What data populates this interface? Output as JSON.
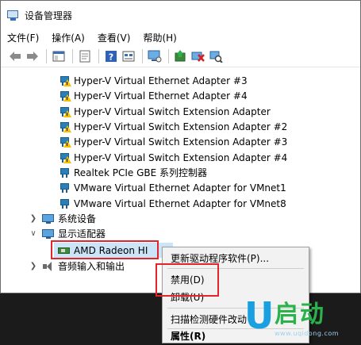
{
  "window": {
    "title": "设备管理器"
  },
  "menubar": {
    "items": [
      "文件(F)",
      "操作(A)",
      "查看(V)",
      "帮助(H)"
    ]
  },
  "toolbar": {
    "icons": [
      "back-arrow-icon",
      "forward-arrow-icon",
      "show-hide-tree-icon",
      "properties-icon",
      "help-icon",
      "view-icon",
      "monitor-icon",
      "update-driver-icon",
      "disable-device-icon",
      "scan-hardware-icon"
    ]
  },
  "tree": {
    "network_adapters": [
      "Hyper-V Virtual Ethernet Adapter #3",
      "Hyper-V Virtual Ethernet Adapter #4",
      "Hyper-V Virtual Switch Extension Adapter",
      "Hyper-V Virtual Switch Extension Adapter #2",
      "Hyper-V Virtual Switch Extension Adapter #3",
      "Hyper-V Virtual Switch Extension Adapter #4",
      "Realtek PCIe GBE 系列控制器",
      "VMware Virtual Ethernet Adapter for VMnet1",
      "VMware Virtual Ethernet Adapter for VMnet8"
    ],
    "system_devices": "系统设备",
    "display_adapters": "显示适配器",
    "selected_device": "AMD Radeon HI",
    "audio": "音频输入和输出"
  },
  "context_menu": {
    "update_driver": "更新驱动程序软件(P)...",
    "disable": "禁用(D)",
    "uninstall": "卸载(U)",
    "scan": "扫描检测硬件改动",
    "properties": "属性(R)"
  },
  "logo": {
    "letter": "U",
    "text": "启动",
    "url": "www.uqidong.com"
  },
  "colors": {
    "highlight": "#e0252b",
    "selection": "#cce4f7",
    "logo_blue": "#1aa0e0",
    "logo_green": "#2bb24c"
  }
}
